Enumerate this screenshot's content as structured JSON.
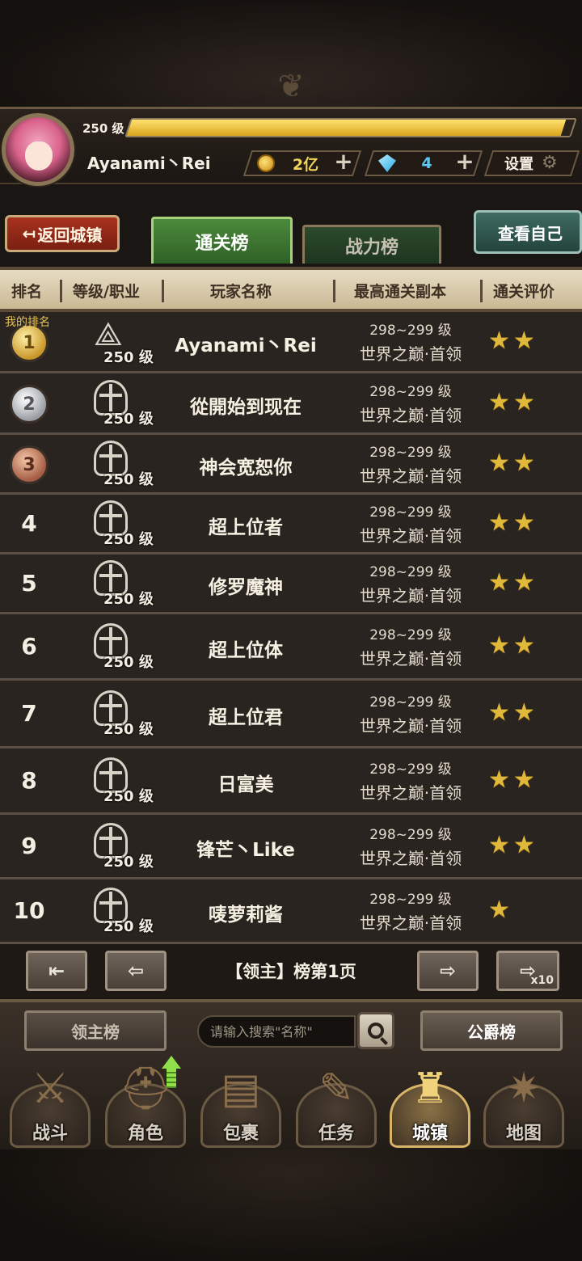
{
  "header": {
    "level": "250 级",
    "exp_progress": 0.98,
    "player_name": "Ayanami丶Rei",
    "gold": "2亿",
    "gems": "4",
    "settings_label": "设置"
  },
  "tabs": {
    "back_label": "返回城镇",
    "active_tab": "通关榜",
    "inactive_tab": "战力榜",
    "view_self_label": "查看自己"
  },
  "columns": {
    "rank": "排名",
    "level_class": "等级/职业",
    "player": "玩家名称",
    "stage": "最高通关副本",
    "rating": "通关评价"
  },
  "my_rank_label": "我的排名",
  "rows": [
    {
      "rank": "1",
      "level": "250 级",
      "name": "Ayanami丶Rei",
      "range": "298~299 级",
      "stage": "世界之巅·首领",
      "stars": 2
    },
    {
      "rank": "2",
      "level": "250 级",
      "name": "從開始到现在",
      "range": "298~299 级",
      "stage": "世界之巅·首领",
      "stars": 2
    },
    {
      "rank": "3",
      "level": "250 级",
      "name": "神会宽恕你",
      "range": "298~299 级",
      "stage": "世界之巅·首领",
      "stars": 2
    },
    {
      "rank": "4",
      "level": "250 级",
      "name": "超上位者",
      "range": "298~299 级",
      "stage": "世界之巅·首领",
      "stars": 2
    },
    {
      "rank": "5",
      "level": "250 级",
      "name": "修罗魔神",
      "range": "298~299 级",
      "stage": "世界之巅·首领",
      "stars": 2
    },
    {
      "rank": "6",
      "level": "250 级",
      "name": "超上位体",
      "range": "298~299 级",
      "stage": "世界之巅·首领",
      "stars": 2
    },
    {
      "rank": "7",
      "level": "250 级",
      "name": "超上位君",
      "range": "298~299 级",
      "stage": "世界之巅·首领",
      "stars": 2
    },
    {
      "rank": "8",
      "level": "250 级",
      "name": "日富美",
      "range": "298~299 级",
      "stage": "世界之巅·首领",
      "stars": 2
    },
    {
      "rank": "9",
      "level": "250 级",
      "name": "锋芒丶Like",
      "range": "298~299 级",
      "stage": "世界之巅·首领",
      "stars": 2
    },
    {
      "rank": "10",
      "level": "250 级",
      "name": "唛萝莉酱",
      "range": "298~299 级",
      "stage": "世界之巅·首领",
      "stars": 1
    }
  ],
  "pager": {
    "page_label": "【领主】榜第1页",
    "x10": "x10"
  },
  "bottom": {
    "lord_rank": "领主榜",
    "search_placeholder": "请输入搜索\"名称\"",
    "duke_rank": "公爵榜"
  },
  "nav": [
    {
      "label": "战斗",
      "icon": "battle-icon"
    },
    {
      "label": "角色",
      "icon": "character-icon"
    },
    {
      "label": "包裹",
      "icon": "bag-icon"
    },
    {
      "label": "任务",
      "icon": "quest-icon"
    },
    {
      "label": "城镇",
      "icon": "town-icon",
      "active": true
    },
    {
      "label": "地图",
      "icon": "map-icon"
    }
  ],
  "colors": {
    "gold_text": "#f2d45a",
    "gem_text": "#5ac8f5",
    "active_tab": "#4c8a3c",
    "back_button": "#a8321f",
    "star": "#e0b83a"
  }
}
